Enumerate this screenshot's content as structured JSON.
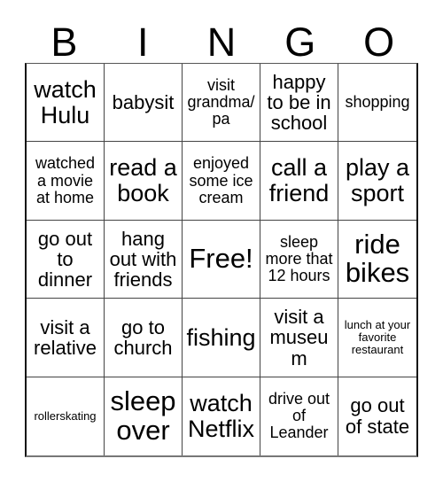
{
  "card": {
    "title": "BINGO",
    "header_letters": [
      "B",
      "I",
      "N",
      "G",
      "O"
    ],
    "free_space_label": "Free!",
    "colors": {
      "background": "#ffffff",
      "text": "#000000",
      "grid_line": "#444444",
      "grid_outer": "#111111"
    },
    "rows": [
      [
        {
          "text": "watch Hulu",
          "size": "lg"
        },
        {
          "text": "babysit",
          "size": "md"
        },
        {
          "text": "visit grandma/pa",
          "size": "sm"
        },
        {
          "text": "happy to be in school",
          "size": "md"
        },
        {
          "text": "shopping",
          "size": "sm"
        }
      ],
      [
        {
          "text": "watched a movie at home",
          "size": "sm"
        },
        {
          "text": "read a book",
          "size": "lg"
        },
        {
          "text": "enjoyed some ice cream",
          "size": "sm"
        },
        {
          "text": "call a friend",
          "size": "lg"
        },
        {
          "text": "play a sport",
          "size": "lg"
        }
      ],
      [
        {
          "text": "go out to dinner",
          "size": "md"
        },
        {
          "text": "hang out with friends",
          "size": "md"
        },
        {
          "text": "Free!",
          "size": "xl"
        },
        {
          "text": "sleep more that 12 hours",
          "size": "sm"
        },
        {
          "text": "ride bikes",
          "size": "xl"
        }
      ],
      [
        {
          "text": "visit a relative",
          "size": "md"
        },
        {
          "text": "go to church",
          "size": "md"
        },
        {
          "text": "fishing",
          "size": "lg"
        },
        {
          "text": "visit a museum",
          "size": "md"
        },
        {
          "text": "lunch at your favorite restaurant",
          "size": "xxs"
        }
      ],
      [
        {
          "text": "rollerskating",
          "size": "xxs"
        },
        {
          "text": "sleep over",
          "size": "xl"
        },
        {
          "text": "watch Netflix",
          "size": "lg"
        },
        {
          "text": "drive out of Leander",
          "size": "sm"
        },
        {
          "text": "go out of state",
          "size": "md"
        }
      ]
    ]
  }
}
